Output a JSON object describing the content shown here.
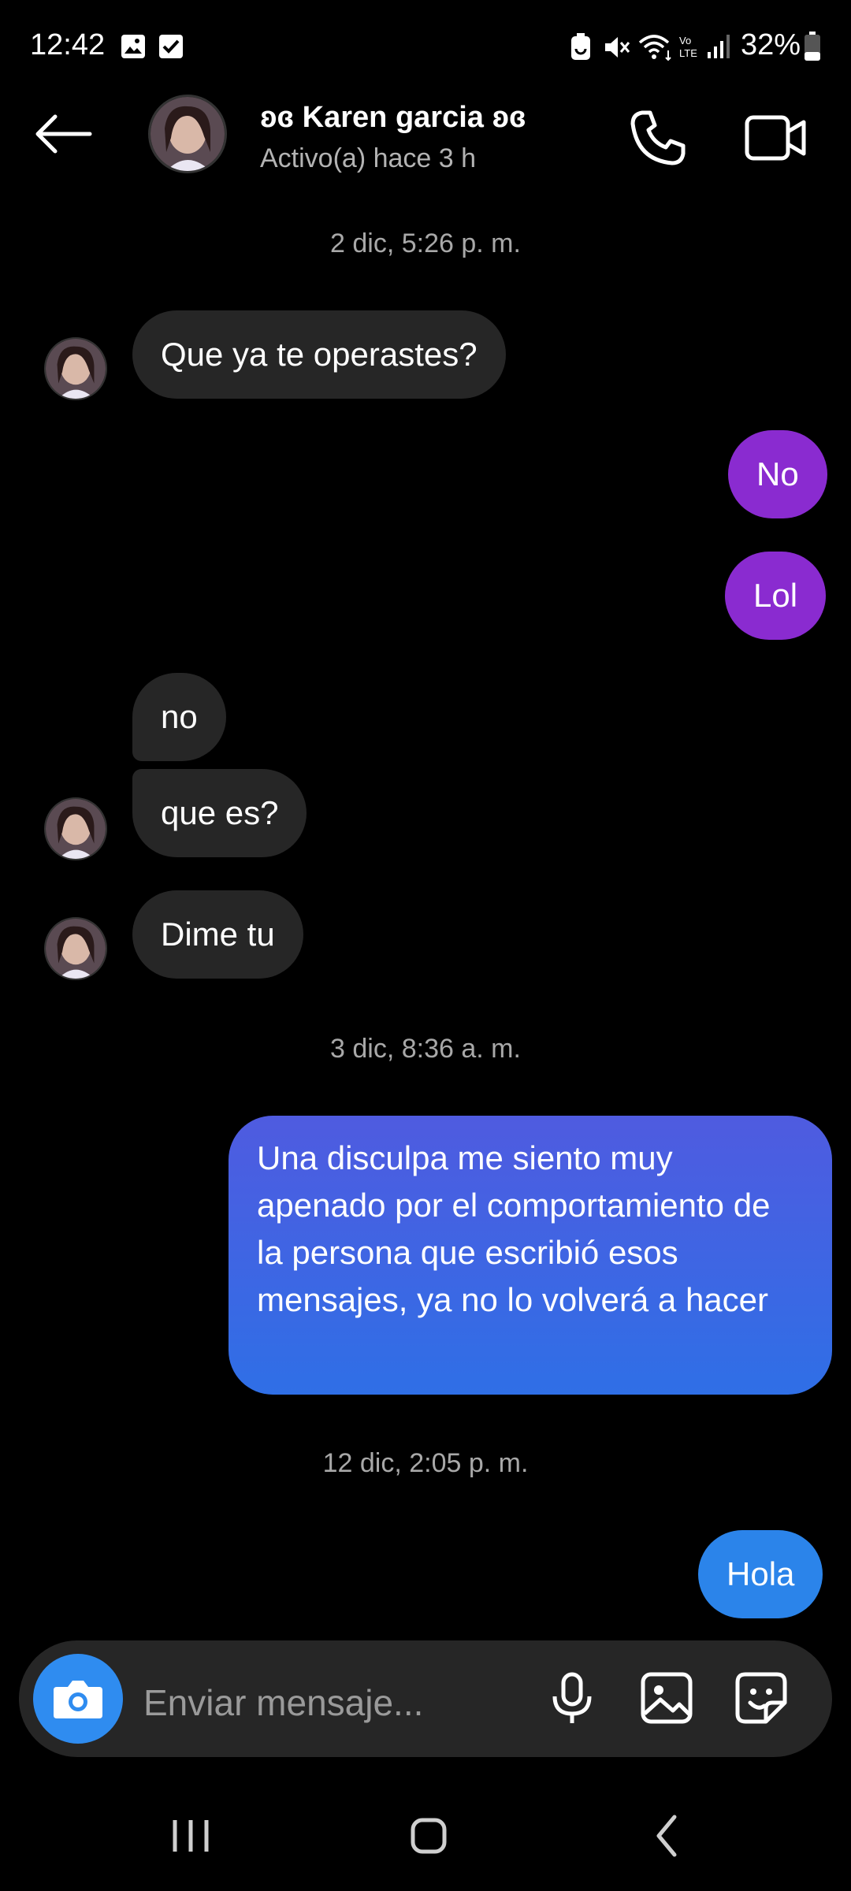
{
  "status_bar": {
    "time": "12:42",
    "battery": "32%",
    "icons": [
      "gallery-icon",
      "checkbox-icon",
      "battery-saver-icon",
      "mute-icon",
      "wifi-icon",
      "volte-icon",
      "signal-icon",
      "battery-icon"
    ]
  },
  "header": {
    "contact_name": "ʚɞ Karen garcia ʚɞ",
    "status": "Activo(a) hace 3 h"
  },
  "messages": [
    {
      "type": "timestamp",
      "text": "2 dic, 5:26 p. m."
    },
    {
      "type": "incoming",
      "text": "Que ya te operastes?"
    },
    {
      "type": "outgoing",
      "text": "No"
    },
    {
      "type": "outgoing",
      "text": "Lol"
    },
    {
      "type": "incoming",
      "text": "no"
    },
    {
      "type": "incoming",
      "text": "que es?"
    },
    {
      "type": "incoming",
      "text": "Dime tu"
    },
    {
      "type": "timestamp",
      "text": "3 dic, 8:36 a. m."
    },
    {
      "type": "outgoing",
      "text": "Una disculpa me siento muy apenado por el comportamiento de la persona que escribió esos mensajes, ya no lo volverá a hacer"
    },
    {
      "type": "timestamp",
      "text": "12 dic, 2:05 p. m."
    },
    {
      "type": "outgoing",
      "text": "Hola"
    }
  ],
  "composer": {
    "placeholder": "Enviar mensaje..."
  },
  "colors": {
    "background": "#000000",
    "incoming_bubble": "#262626",
    "outgoing_purple": "#8a2bd0",
    "outgoing_blue": "#2b84ea",
    "camera_button": "#2f8cf0"
  }
}
